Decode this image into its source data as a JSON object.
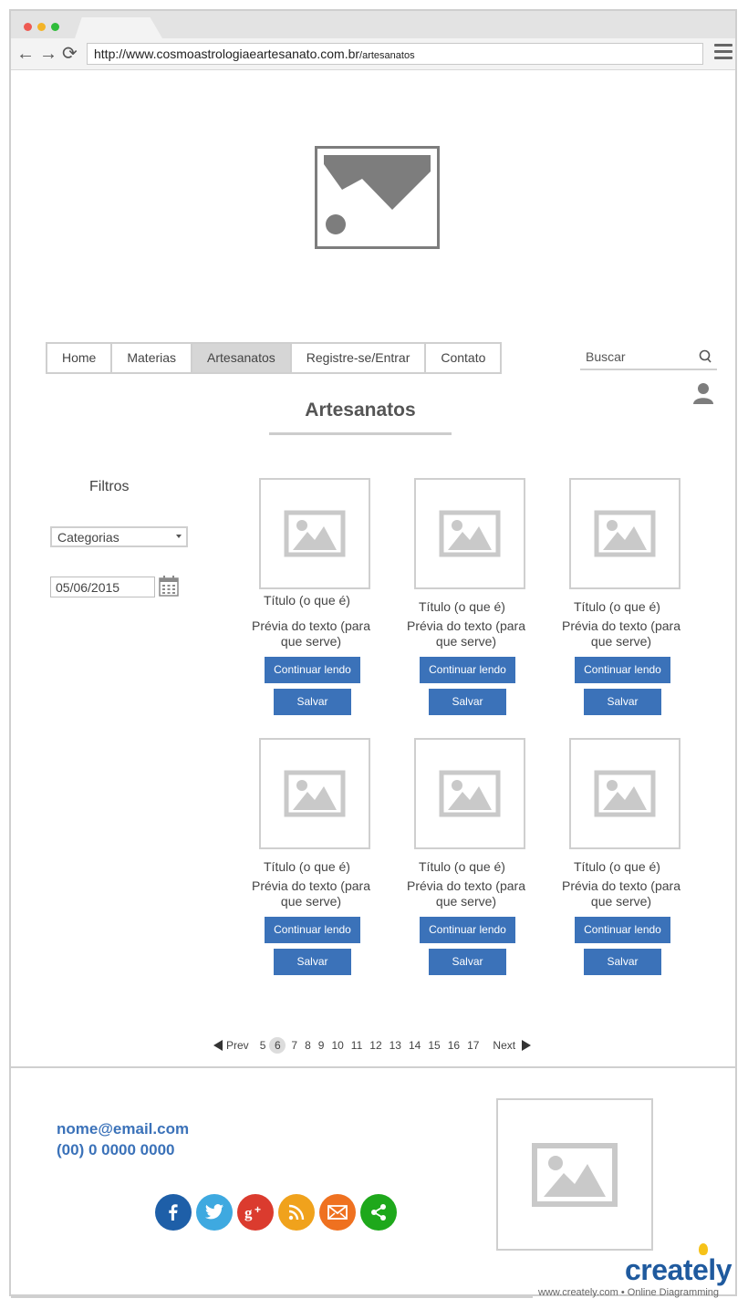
{
  "browser": {
    "url_base": "http://www.cosmoastrologiaeartesanato.com.br",
    "url_path": "/artesanatos",
    "back_glyph": "←",
    "forward_glyph": "→",
    "reload_glyph": "⟳"
  },
  "nav": {
    "items": [
      {
        "label": "Home",
        "active": false
      },
      {
        "label": "Materias",
        "active": false
      },
      {
        "label": "Artesanatos",
        "active": true
      },
      {
        "label": "Registre-se/Entrar",
        "active": false
      },
      {
        "label": "Contato",
        "active": false
      }
    ]
  },
  "search": {
    "placeholder": "Buscar"
  },
  "page": {
    "title": "Artesanatos"
  },
  "filters": {
    "label": "Filtros",
    "category_selected": "Categorias",
    "date_value": "05/06/2015"
  },
  "cards": [
    {
      "title": "Título (o que é)",
      "preview": "Prévia do texto (para que serve)",
      "continue_label": "Continuar lendo",
      "save_label": "Salvar"
    },
    {
      "title": "Título (o que é)",
      "preview": "Prévia do texto (para que serve)",
      "continue_label": "Continuar lendo",
      "save_label": "Salvar"
    },
    {
      "title": "Título (o que é)",
      "preview": "Prévia do texto (para que serve)",
      "continue_label": "Continuar lendo",
      "save_label": "Salvar"
    },
    {
      "title": "Título (o que é)",
      "preview": "Prévia do texto (para que serve)",
      "continue_label": "Continuar lendo",
      "save_label": "Salvar"
    },
    {
      "title": "Título (o que é)",
      "preview": "Prévia do texto (para que serve)",
      "continue_label": "Continuar lendo",
      "save_label": "Salvar"
    },
    {
      "title": "Título (o que é)",
      "preview": "Prévia do texto (para que serve)",
      "continue_label": "Continuar lendo",
      "save_label": "Salvar"
    }
  ],
  "pagination": {
    "prev_label": "Prev",
    "next_label": "Next",
    "pages": [
      "5",
      "6",
      "7",
      "8",
      "9",
      "10",
      "11",
      "12",
      "13",
      "14",
      "15",
      "16",
      "17"
    ],
    "current": "6"
  },
  "footer": {
    "email": "nome@email.com",
    "phone": "(00) 0 0000 0000",
    "social": [
      {
        "icon": "facebook-icon",
        "color": "#1e5fa8"
      },
      {
        "icon": "twitter-icon",
        "color": "#3ea9e0"
      },
      {
        "icon": "google-plus-icon",
        "color": "#db3b2e"
      },
      {
        "icon": "rss-icon",
        "color": "#f0a21c"
      },
      {
        "icon": "mail-icon",
        "color": "#ef7120"
      },
      {
        "icon": "share-icon",
        "color": "#1ea81b"
      }
    ]
  },
  "watermark": {
    "logo_text": "creately",
    "tagline": "www.creately.com • Online Diagramming"
  }
}
